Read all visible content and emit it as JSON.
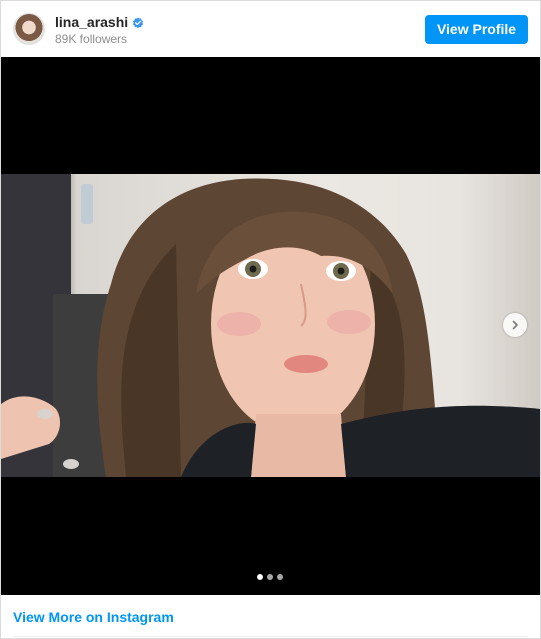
{
  "header": {
    "username": "lina_arashi",
    "verified": true,
    "followers": "89K followers",
    "view_profile_label": "View Profile"
  },
  "media": {
    "icons": [
      "chevron-right-icon"
    ],
    "carousel": {
      "total": 3,
      "active_index": 0
    }
  },
  "footer": {
    "view_more_label": "View More on Instagram"
  },
  "colors": {
    "accent": "#0095f6",
    "text_primary": "#262626",
    "text_secondary": "#8e8e8e",
    "media_background": "#000000"
  }
}
